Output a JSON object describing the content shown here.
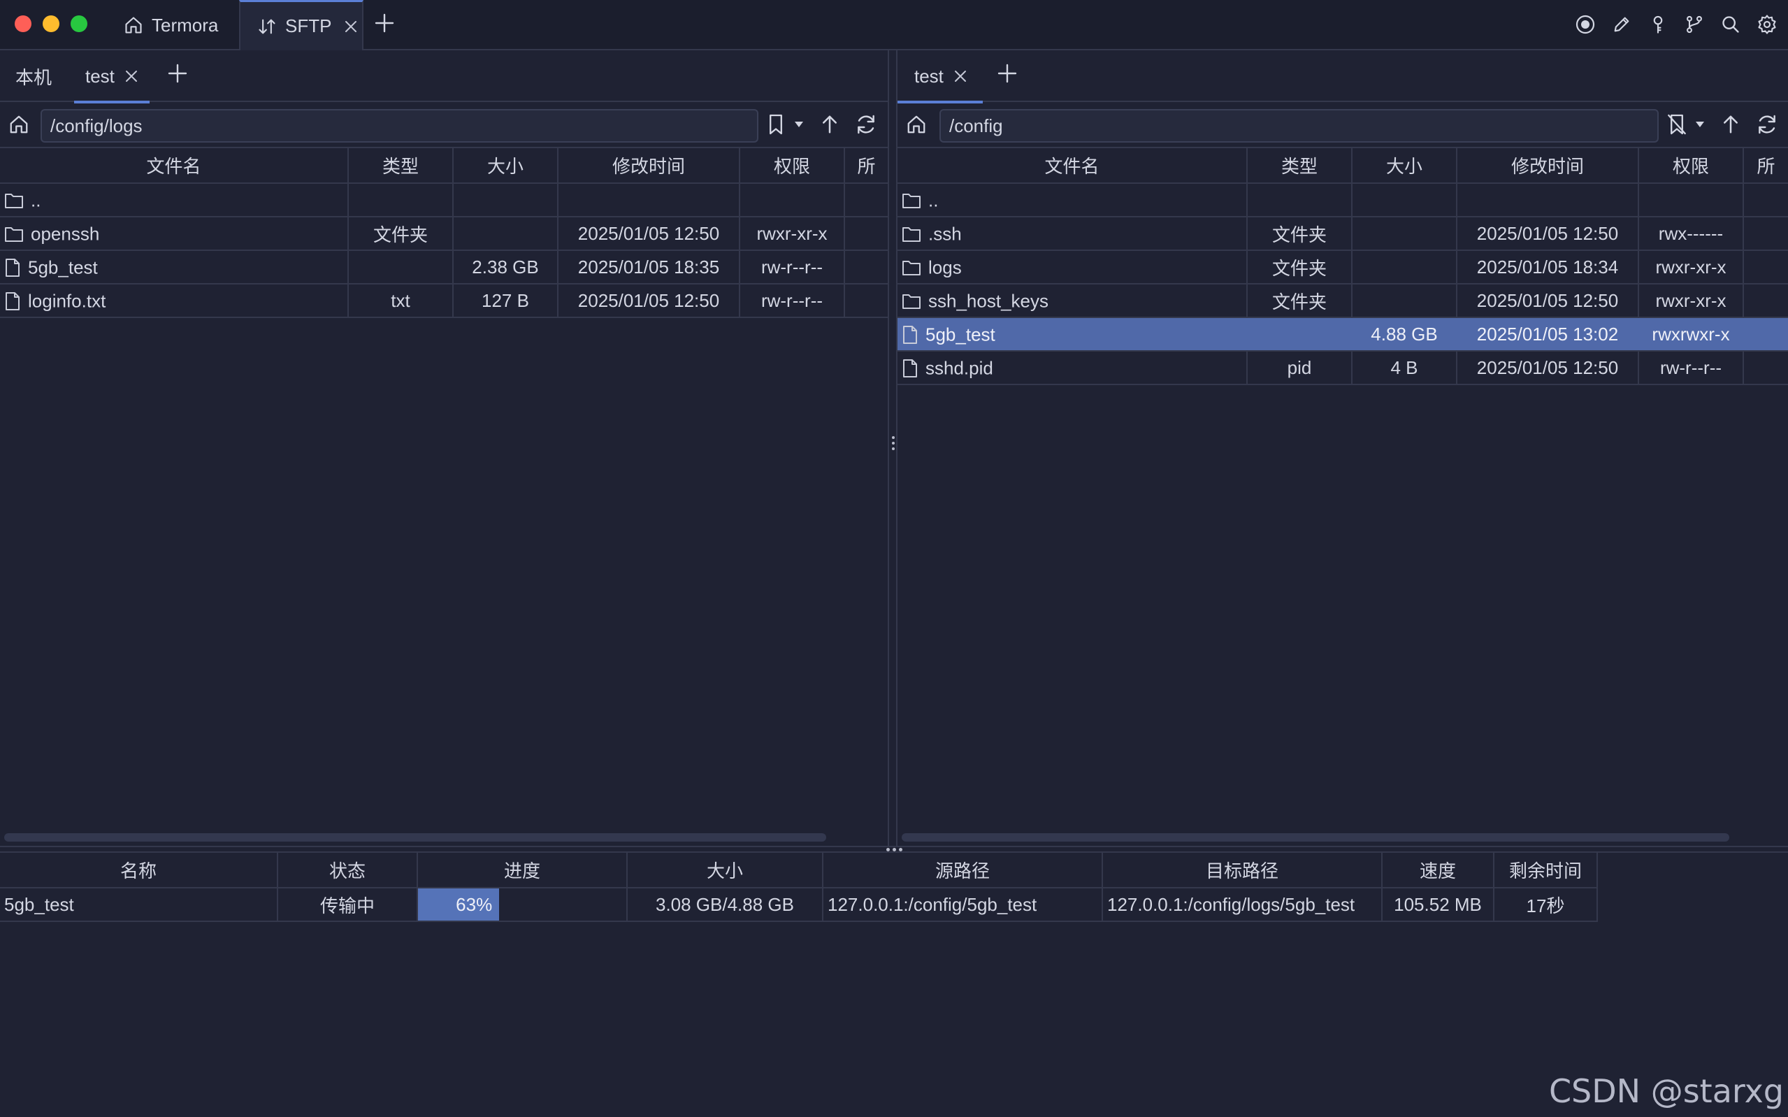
{
  "window": {
    "tabs": [
      {
        "label": "Termora",
        "icon": "home-icon"
      },
      {
        "label": "SFTP",
        "icon": "transfer-arrows-icon",
        "active": true
      }
    ],
    "toolbar_icons": [
      "record-icon",
      "pencil-icon",
      "key-icon",
      "branch-icon",
      "search-icon",
      "gear-icon"
    ]
  },
  "colors": {
    "background": "#1f2233",
    "titlebar": "#1b1e2d",
    "accent": "#5b7fd6",
    "selection": "#5069a9",
    "progress_fill": "#5573b8"
  },
  "left_pane": {
    "tabs": [
      {
        "label": "本机",
        "active": false
      },
      {
        "label": "test",
        "active": true
      }
    ],
    "path": "/config/logs",
    "columns": [
      "文件名",
      "类型",
      "大小",
      "修改时间",
      "权限",
      "所"
    ],
    "rows": [
      {
        "name": "..",
        "kind": "folder",
        "type": "",
        "size": "",
        "modified": "",
        "perms": ""
      },
      {
        "name": "openssh",
        "kind": "folder",
        "type": "文件夹",
        "size": "",
        "modified": "2025/01/05 12:50",
        "perms": "rwxr-xr-x"
      },
      {
        "name": "5gb_test",
        "kind": "file",
        "type": "",
        "size": "2.38 GB",
        "modified": "2025/01/05 18:35",
        "perms": "rw-r--r--"
      },
      {
        "name": "loginfo.txt",
        "kind": "file",
        "type": "txt",
        "size": "127 B",
        "modified": "2025/01/05 12:50",
        "perms": "rw-r--r--"
      }
    ]
  },
  "right_pane": {
    "tabs": [
      {
        "label": "test",
        "active": true
      }
    ],
    "path": "/config",
    "columns": [
      "文件名",
      "类型",
      "大小",
      "修改时间",
      "权限",
      "所"
    ],
    "rows": [
      {
        "name": "..",
        "kind": "folder",
        "type": "",
        "size": "",
        "modified": "",
        "perms": ""
      },
      {
        "name": ".ssh",
        "kind": "folder",
        "type": "文件夹",
        "size": "",
        "modified": "2025/01/05 12:50",
        "perms": "rwx------"
      },
      {
        "name": "logs",
        "kind": "folder",
        "type": "文件夹",
        "size": "",
        "modified": "2025/01/05 18:34",
        "perms": "rwxr-xr-x"
      },
      {
        "name": "ssh_host_keys",
        "kind": "folder",
        "type": "文件夹",
        "size": "",
        "modified": "2025/01/05 12:50",
        "perms": "rwxr-xr-x"
      },
      {
        "name": "5gb_test",
        "kind": "file",
        "type": "",
        "size": "4.88 GB",
        "modified": "2025/01/05 13:02",
        "perms": "rwxrwxr-x",
        "selected": true
      },
      {
        "name": "sshd.pid",
        "kind": "file",
        "type": "pid",
        "size": "4 B",
        "modified": "2025/01/05 12:50",
        "perms": "rw-r--r--"
      }
    ]
  },
  "transfers": {
    "columns": [
      "名称",
      "状态",
      "进度",
      "大小",
      "源路径",
      "目标路径",
      "速度",
      "剩余时间"
    ],
    "rows": [
      {
        "name": "5gb_test",
        "status": "传输中",
        "progress": 0.63,
        "progress_label": "63%",
        "size": "3.08 GB/4.88 GB",
        "source": "127.0.0.1:/config/5gb_test",
        "target": "127.0.0.1:/config/logs/5gb_test",
        "speed": "105.52 MB",
        "remaining": "17秒"
      }
    ]
  },
  "watermark": "CSDN @starxg"
}
